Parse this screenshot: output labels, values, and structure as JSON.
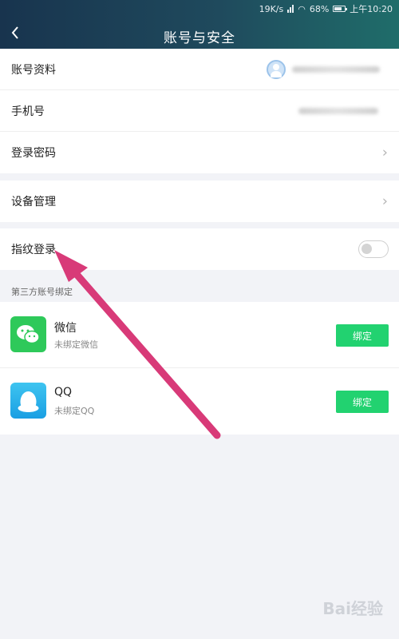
{
  "status_bar": {
    "speed": "19K/s",
    "battery": "68%",
    "time": "上午10:20"
  },
  "header": {
    "title": "账号与安全",
    "back_icon": "chevron-left-icon"
  },
  "account_group": {
    "profile_label": "账号资料",
    "phone_label": "手机号",
    "password_label": "登录密码"
  },
  "device_group": {
    "device_label": "设备管理"
  },
  "fingerprint_group": {
    "fingerprint_label": "指纹登录",
    "enabled": false
  },
  "third_party": {
    "section_label": "第三方账号绑定",
    "items": [
      {
        "name": "微信",
        "status": "未绑定微信",
        "button": "绑定",
        "icon": "wechat-icon"
      },
      {
        "name": "QQ",
        "status": "未绑定QQ",
        "button": "绑定",
        "icon": "qq-icon"
      }
    ]
  },
  "colors": {
    "header_start": "#18344e",
    "header_end": "#1f6d6a",
    "bind_green": "#22d270",
    "arrow": "#d83a78"
  },
  "watermark": "Bai经验"
}
